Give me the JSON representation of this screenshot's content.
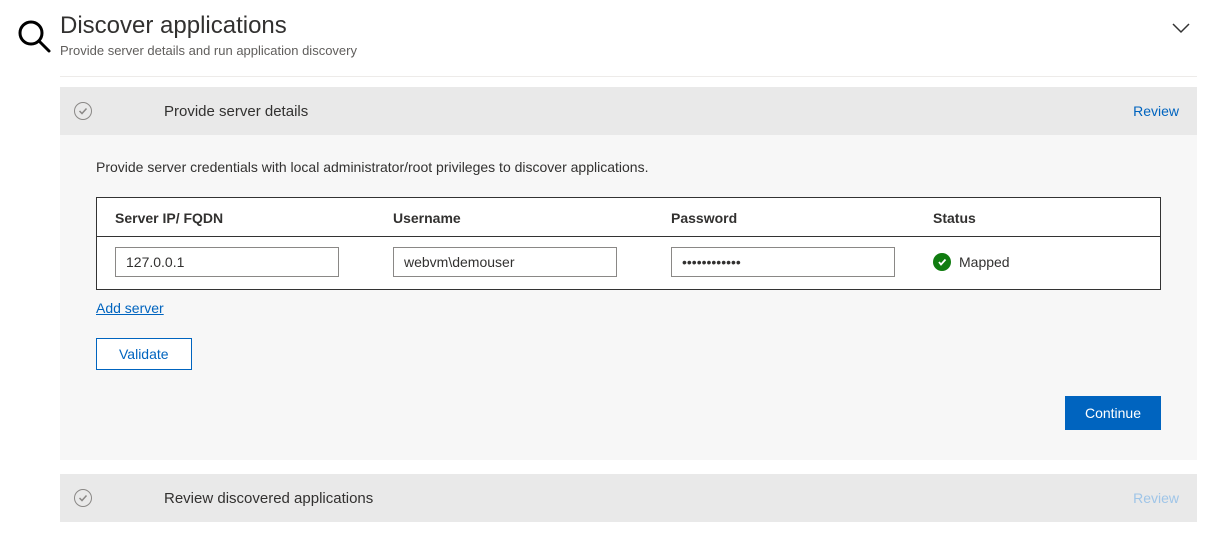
{
  "header": {
    "title": "Discover applications",
    "subtitle": "Provide server details and run application discovery"
  },
  "steps": {
    "step1": {
      "title": "Provide server details",
      "review_label": "Review",
      "instruction": "Provide server credentials with local administrator/root privileges to discover applications.",
      "table": {
        "headers": {
          "ip": "Server IP/ FQDN",
          "username": "Username",
          "password": "Password",
          "status": "Status"
        },
        "row": {
          "ip": "127.0.0.1",
          "username": "webvm\\demouser",
          "password": "••••••••••••",
          "status_label": "Mapped"
        }
      },
      "add_server_label": "Add server",
      "validate_label": "Validate",
      "continue_label": "Continue"
    },
    "step2": {
      "title": "Review discovered applications",
      "review_label": "Review"
    }
  }
}
